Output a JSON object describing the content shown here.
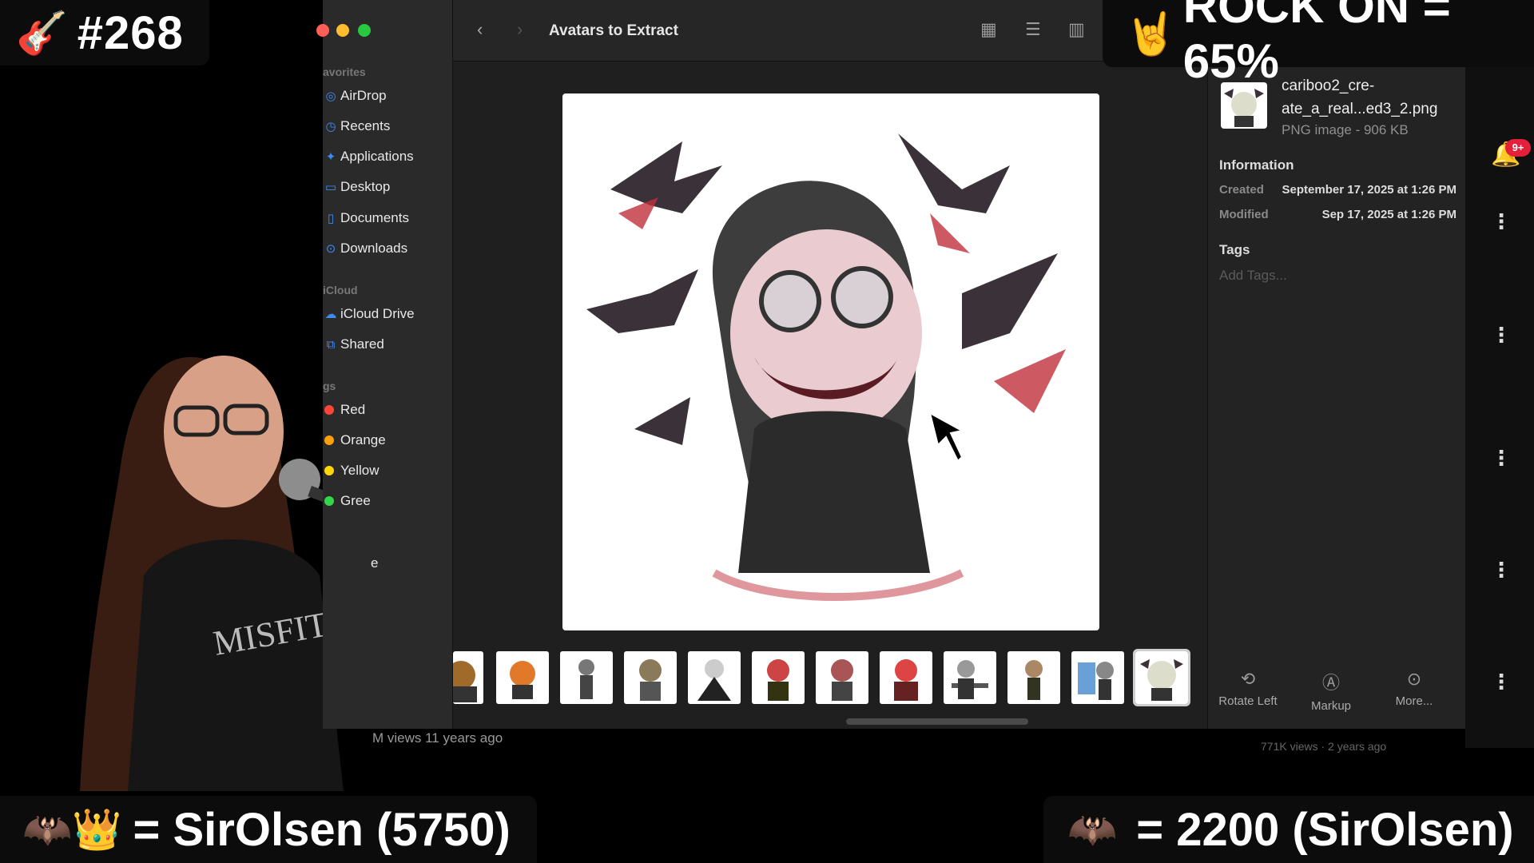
{
  "overlays": {
    "episode": {
      "emoji": "🎸",
      "text": "#268"
    },
    "rock_on": {
      "emoji": "🤘",
      "text": "ROCK ON = 65%"
    },
    "king": {
      "emoji": "🦇👑",
      "text": "= SirOlsen (5750)"
    },
    "bat_count": {
      "emoji": "🦇",
      "text": "=  2200 (SirOlsen)"
    }
  },
  "finder": {
    "title": "Avatars to Extract",
    "sidebar": {
      "favorites_header": "avorites",
      "favorites": [
        {
          "label": "AirDrop",
          "icon": "airdrop-icon"
        },
        {
          "label": "Recents",
          "icon": "clock-icon"
        },
        {
          "label": "Applications",
          "icon": "applications-icon"
        },
        {
          "label": "Desktop",
          "icon": "desktop-icon"
        },
        {
          "label": "Documents",
          "icon": "document-icon"
        },
        {
          "label": "Downloads",
          "icon": "download-icon"
        }
      ],
      "icloud_header": "iCloud",
      "icloud": [
        {
          "label": "iCloud Drive",
          "icon": "cloud-icon"
        },
        {
          "label": "Shared",
          "icon": "shared-folder-icon"
        }
      ],
      "tags_header": "gs",
      "tags": [
        {
          "label": "Red",
          "color": "#ff453a"
        },
        {
          "label": "Orange",
          "color": "#ff9f0a"
        },
        {
          "label": "Yellow",
          "color": "#ffd60a"
        },
        {
          "label": "Gree",
          "color": "#32d74b"
        }
      ],
      "partial_text": "e"
    },
    "inspector": {
      "filename": "cariboo2_cre-ate_a_real...ed3_2.png",
      "kind": "PNG image - 906 KB",
      "info_header": "Information",
      "created_label": "Created",
      "created_value": "September 17, 2025 at 1:26 PM",
      "modified_label": "Modified",
      "modified_value": "Sep 17, 2025 at 1:26 PM",
      "tags_header": "Tags",
      "tags_placeholder": "Add Tags...",
      "actions": [
        {
          "label": "Rotate Left",
          "icon": "rotate-left-icon"
        },
        {
          "label": "Markup",
          "icon": "markup-icon"
        },
        {
          "label": "More...",
          "icon": "more-icon"
        }
      ]
    }
  },
  "background": {
    "views_text": "M views  11 years ago",
    "notification_badge": "9+",
    "video_meta": "771K views · 2 years ago"
  }
}
